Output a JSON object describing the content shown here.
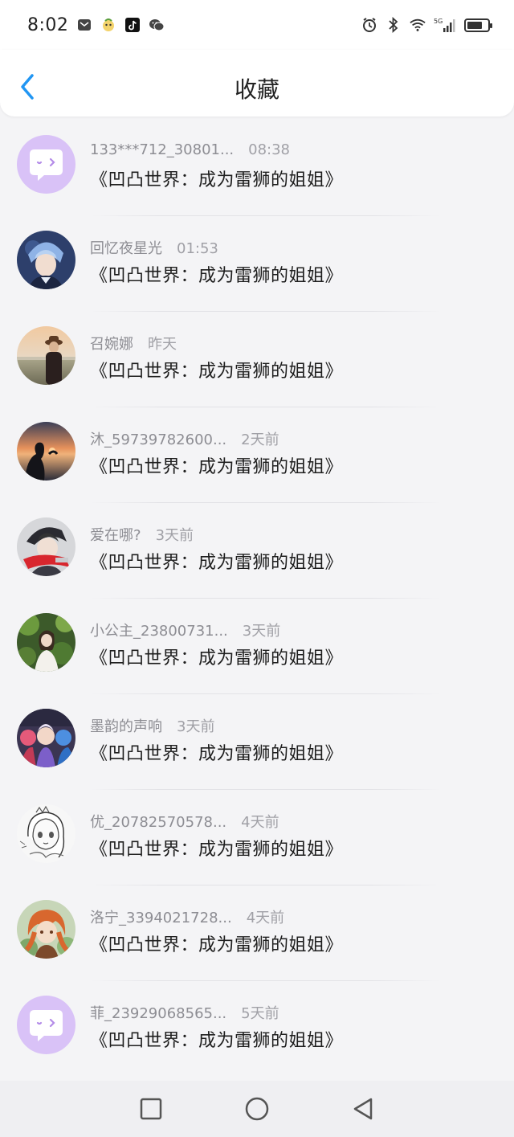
{
  "status_bar": {
    "time": "8:02",
    "network_label": "5G"
  },
  "header": {
    "title": "收藏"
  },
  "items": [
    {
      "user": "133***712_30801...",
      "time": "08:38",
      "book": "《凹凸世界：成为雷狮的姐姐》",
      "avatar": "default-chat-avatar"
    },
    {
      "user": "回忆夜星光",
      "time": "01:53",
      "book": "《凹凸世界：成为雷狮的姐姐》",
      "avatar": "anime-boy-avatar"
    },
    {
      "user": "召婉娜",
      "time": "昨天",
      "book": "《凹凸世界：成为雷狮的姐姐》",
      "avatar": "photo-person-avatar"
    },
    {
      "user": "沐_59739782600...",
      "time": "2天前",
      "book": "《凹凸世界：成为雷狮的姐姐》",
      "avatar": "sunset-avatar"
    },
    {
      "user": "爱在哪?",
      "time": "3天前",
      "book": "《凹凸世界：成为雷狮的姐姐》",
      "avatar": "anime-red-scarf-avatar"
    },
    {
      "user": "小公主_23800731...",
      "time": "3天前",
      "book": "《凹凸世界：成为雷狮的姐姐》",
      "avatar": "forest-girl-avatar"
    },
    {
      "user": "墨韵的声响",
      "time": "3天前",
      "book": "《凹凸世界：成为雷狮的姐姐》",
      "avatar": "anime-group-avatar"
    },
    {
      "user": "优_20782570578...",
      "time": "4天前",
      "book": "《凹凸世界：成为雷狮的姐姐》",
      "avatar": "sketch-girl-avatar"
    },
    {
      "user": "洛宁_3394021728...",
      "time": "4天前",
      "book": "《凹凸世界：成为雷狮的姐姐》",
      "avatar": "anime-orange-hair-avatar"
    },
    {
      "user": "菲_23929068565...",
      "time": "5天前",
      "book": "《凹凸世界：成为雷狮的姐姐》",
      "avatar": "default-chat-avatar"
    }
  ],
  "colors": {
    "accent": "#2196f3",
    "default_avatar_bg": "#d9c2f7"
  }
}
